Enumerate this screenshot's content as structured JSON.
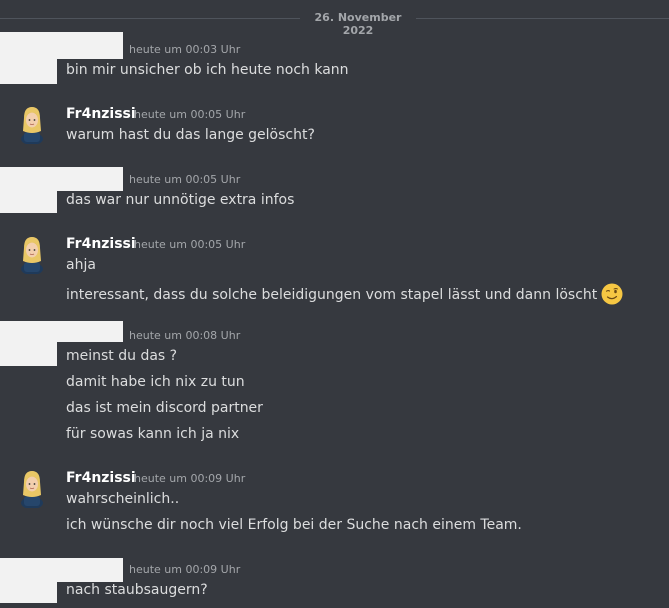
{
  "date_divider": "26. November 2022",
  "messages": [
    {
      "author": "",
      "timestamp": "heute um 00:03 Uhr",
      "lines": [
        "bin mir unsicher ob ich heute noch kann"
      ]
    },
    {
      "author": "Fr4nzissi",
      "timestamp": "heute um 00:05 Uhr",
      "lines": [
        "warum hast du das lange gelöscht?"
      ]
    },
    {
      "author": "",
      "timestamp": "heute um 00:05 Uhr",
      "lines": [
        "das war nur unnötige extra infos"
      ]
    },
    {
      "author": "Fr4nzissi",
      "timestamp": "heute um 00:05 Uhr",
      "lines": [
        "ahja",
        "interessant, dass du solche beleidigungen vom stapel lässt und dann löscht"
      ]
    },
    {
      "author": "",
      "timestamp": "heute um 00:08 Uhr",
      "lines": [
        "meinst du das ?",
        "damit habe ich nix zu tun",
        "das ist mein discord partner",
        "für sowas kann ich ja nix"
      ]
    },
    {
      "author": "Fr4nzissi",
      "timestamp": "heute um 00:09 Uhr",
      "lines": [
        "wahrscheinlich..",
        "ich wünsche dir noch viel Erfolg bei der Suche nach einem Team."
      ]
    },
    {
      "author": "",
      "timestamp": "heute um 00:09 Uhr",
      "lines": [
        "nach staubsaugern?"
      ]
    }
  ],
  "emoji": "winking-face-emoji",
  "colors": {
    "background": "#36393f",
    "text": "#dcddde",
    "username": "#ffffff",
    "timestamp": "#a3a6aa",
    "redaction": "#f2f2f2"
  }
}
